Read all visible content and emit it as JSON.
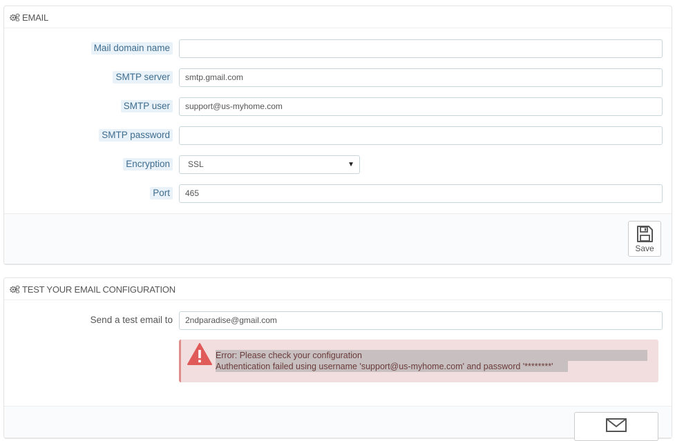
{
  "email_panel": {
    "title": "EMAIL",
    "fields": [
      {
        "label": "Mail domain name",
        "value": ""
      },
      {
        "label": "SMTP server",
        "value": "smtp.gmail.com"
      },
      {
        "label": "SMTP user",
        "value": "support@us-myhome.com"
      },
      {
        "label": "SMTP password",
        "value": ""
      },
      {
        "label": "Encryption",
        "value": "SSL"
      },
      {
        "label": "Port",
        "value": "465"
      }
    ],
    "save_label": "Save"
  },
  "test_panel": {
    "title": "TEST YOUR EMAIL CONFIGURATION",
    "send_label": "Send a test email to",
    "send_value": "2ndparadise@gmail.com",
    "error_line1": "Error: Please check your configuration",
    "error_line2": "Authentication failed using username 'support@us-myhome.com' and password '********'"
  },
  "icons": [
    "gears-icon",
    "floppy-disk-icon",
    "warning-icon",
    "envelope-icon",
    "caret-down-icon"
  ],
  "colors": {
    "label_highlight": "#e9f2f8",
    "label_text": "#3e6c8f",
    "alert_bg": "#f2dede",
    "alert_icon": "#e05a5a"
  }
}
